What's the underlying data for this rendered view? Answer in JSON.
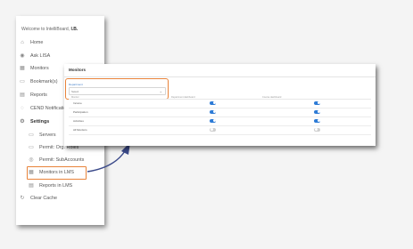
{
  "sidebar": {
    "welcome_prefix": "Welcome to IntelliBoard,",
    "welcome_user": "I.B.",
    "items": [
      {
        "label": "Home",
        "icon": "home-icon"
      },
      {
        "label": "Ask LISA",
        "icon": "assistant-icon"
      },
      {
        "label": "Monitors",
        "icon": "monitor-icon"
      },
      {
        "label": "Bookmark(s)",
        "icon": "bookmark-icon"
      },
      {
        "label": "Reports",
        "icon": "report-icon"
      },
      {
        "label": "CEND Notifications",
        "icon": "bell-icon"
      },
      {
        "label": "Settings",
        "icon": "gear-icon"
      },
      {
        "label": "Servers",
        "icon": "server-icon"
      },
      {
        "label": "Permit: Org. Roles",
        "icon": "permit-icon"
      },
      {
        "label": "Permit: SubAccounts",
        "icon": "eye-icon"
      },
      {
        "label": "Monitors in LMS",
        "icon": "grid-icon"
      },
      {
        "label": "Reports in LMS",
        "icon": "report-icon"
      },
      {
        "label": "Clear Cache",
        "icon": "refresh-icon"
      }
    ]
  },
  "panel": {
    "title": "Monitors",
    "department": {
      "label": "Department",
      "value": "Select"
    },
    "columns": [
      "Monitor",
      "Department dashboard",
      "Course dashboard"
    ],
    "rows": [
      {
        "label": "Income",
        "dept": true,
        "course": true
      },
      {
        "label": "Participation",
        "dept": true,
        "course": true
      },
      {
        "label": "Activities",
        "dept": true,
        "course": true
      },
      {
        "label": "All Monitors",
        "dept": false,
        "course": false
      }
    ]
  },
  "colors": {
    "accent": "#e8833a",
    "toggle_on": "#2d7bd6",
    "link": "#3a7bc8"
  }
}
